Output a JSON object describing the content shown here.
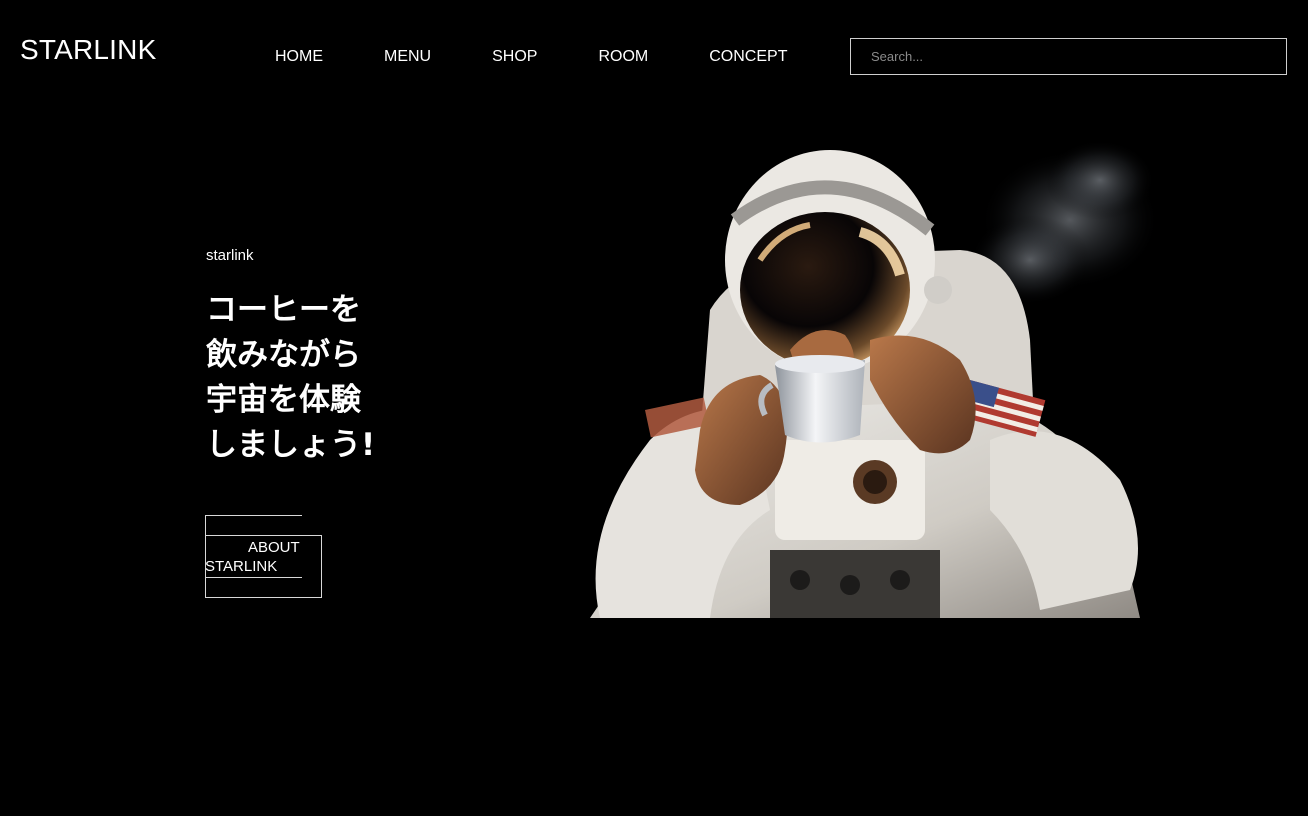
{
  "brand": {
    "logo": "STARLINK"
  },
  "nav": {
    "items": [
      {
        "label": "HOME"
      },
      {
        "label": "MENU"
      },
      {
        "label": "SHOP"
      },
      {
        "label": "ROOM"
      },
      {
        "label": "CONCEPT"
      }
    ]
  },
  "search": {
    "placeholder": "Search..."
  },
  "hero": {
    "tagline": "starlink",
    "headline_lines": [
      "コーヒーを",
      "飲みながら",
      "宇宙を体験",
      "しましょう!"
    ],
    "button": {
      "line1": "ABOUT",
      "line2": "STARLINK"
    },
    "image_icon": "astronaut-with-coffee-image"
  },
  "colors": {
    "background": "#000000",
    "text": "#ffffff",
    "border": "#cfcfcf",
    "placeholder": "#8a8a8a"
  }
}
